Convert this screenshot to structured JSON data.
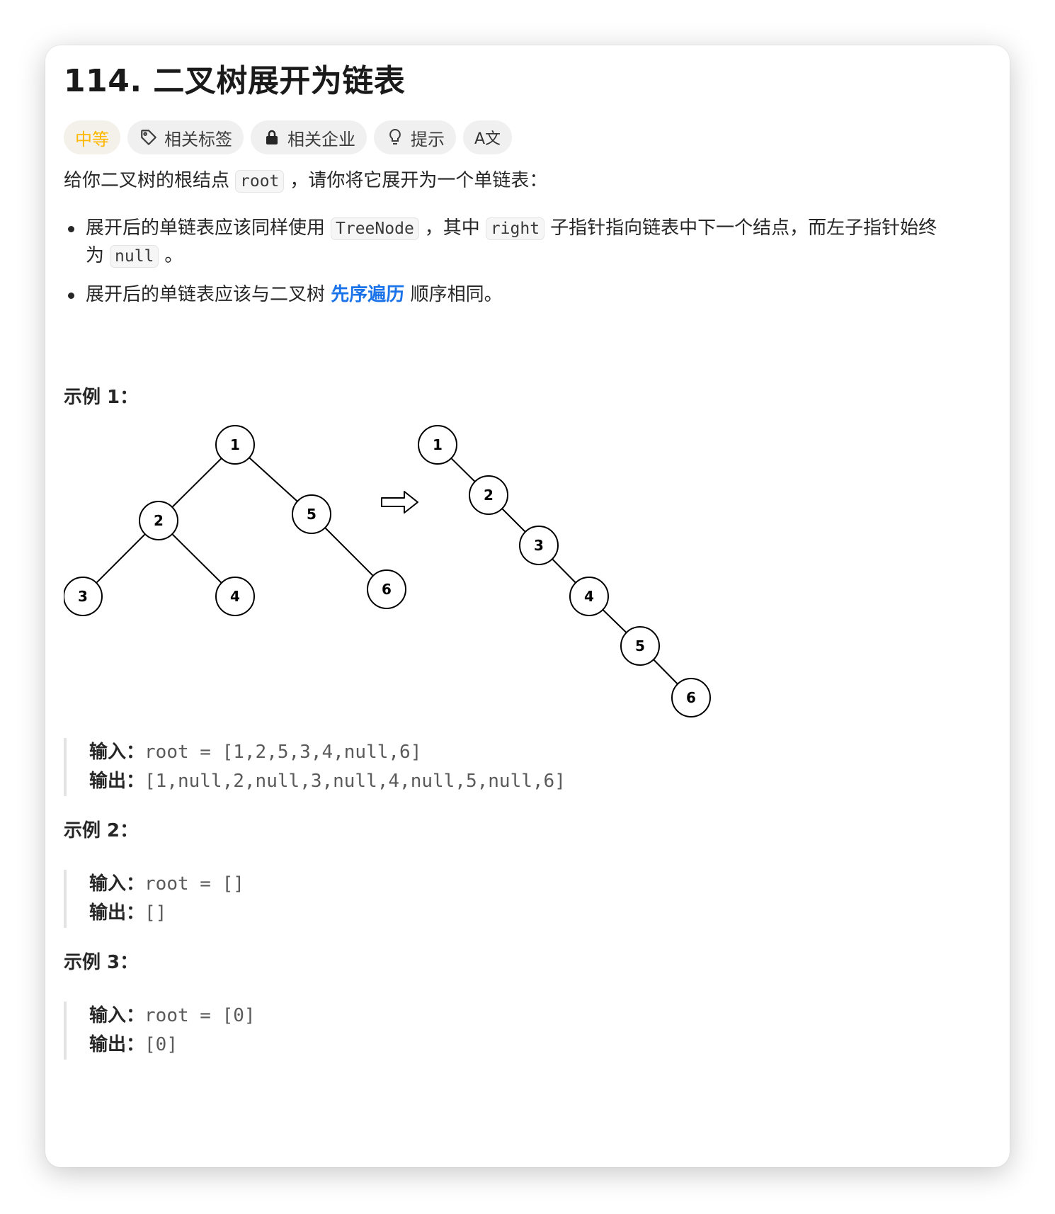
{
  "problem": {
    "title": "114. 二叉树展开为链表",
    "difficulty": "中等",
    "tags": [
      {
        "label": "相关标签",
        "icon": "tag-icon"
      },
      {
        "label": "相关企业",
        "icon": "lock-icon"
      },
      {
        "label": "提示",
        "icon": "lightbulb-icon"
      }
    ],
    "translate_icon_text": "A文"
  },
  "description": {
    "intro_before": "给你二叉树的根结点",
    "intro_code": "root",
    "intro_after": "，请你将它展开为一个单链表：",
    "bullet1_a": "展开后的单链表应该同样使用",
    "bullet1_code1": "TreeNode",
    "bullet1_b": "，其中",
    "bullet1_code2": "right",
    "bullet1_c": "子指针指向链表中下一个结点，而左子指针始终",
    "bullet1_d": "为",
    "bullet1_code3": "null",
    "bullet1_e": "。",
    "bullet2_a": "展开后的单链表应该与二叉树",
    "bullet2_link": "先序遍历",
    "bullet2_b": "顺序相同。"
  },
  "diagram": {
    "tree_nodes": [
      "1",
      "2",
      "5",
      "3",
      "4",
      "6"
    ],
    "list_nodes": [
      "1",
      "2",
      "3",
      "4",
      "5",
      "6"
    ]
  },
  "examples": [
    {
      "title": "示例 1：",
      "input_label": "输入：",
      "input": "root = [1,2,5,3,4,null,6]",
      "output_label": "输出：",
      "output": "[1,null,2,null,3,null,4,null,5,null,6]"
    },
    {
      "title": "示例 2：",
      "input_label": "输入：",
      "input": "root = []",
      "output_label": "输出：",
      "output": "[]"
    },
    {
      "title": "示例 3：",
      "input_label": "输入：",
      "input": "root = [0]",
      "output_label": "输出：",
      "output": "[0]"
    }
  ],
  "colors": {
    "difficulty": "#ffb800",
    "link": "#1a73e8"
  }
}
